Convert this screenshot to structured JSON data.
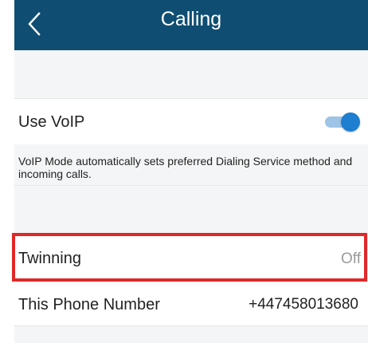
{
  "header": {
    "title": "Calling",
    "back_icon": "chevron-left-icon",
    "background_color": "#0f4e72"
  },
  "settings": {
    "voip": {
      "label": "Use VoIP",
      "enabled": true,
      "description": "VoIP Mode automatically sets preferred Dialing Service method and incoming calls."
    },
    "twinning": {
      "label": "Twinning",
      "value": "Off",
      "highlight_color": "#e02828"
    },
    "phone": {
      "label": "This Phone Number",
      "value": "+447458013680"
    }
  },
  "colors": {
    "accent": "#1e7ed0",
    "section_background": "#f4f5f6"
  }
}
